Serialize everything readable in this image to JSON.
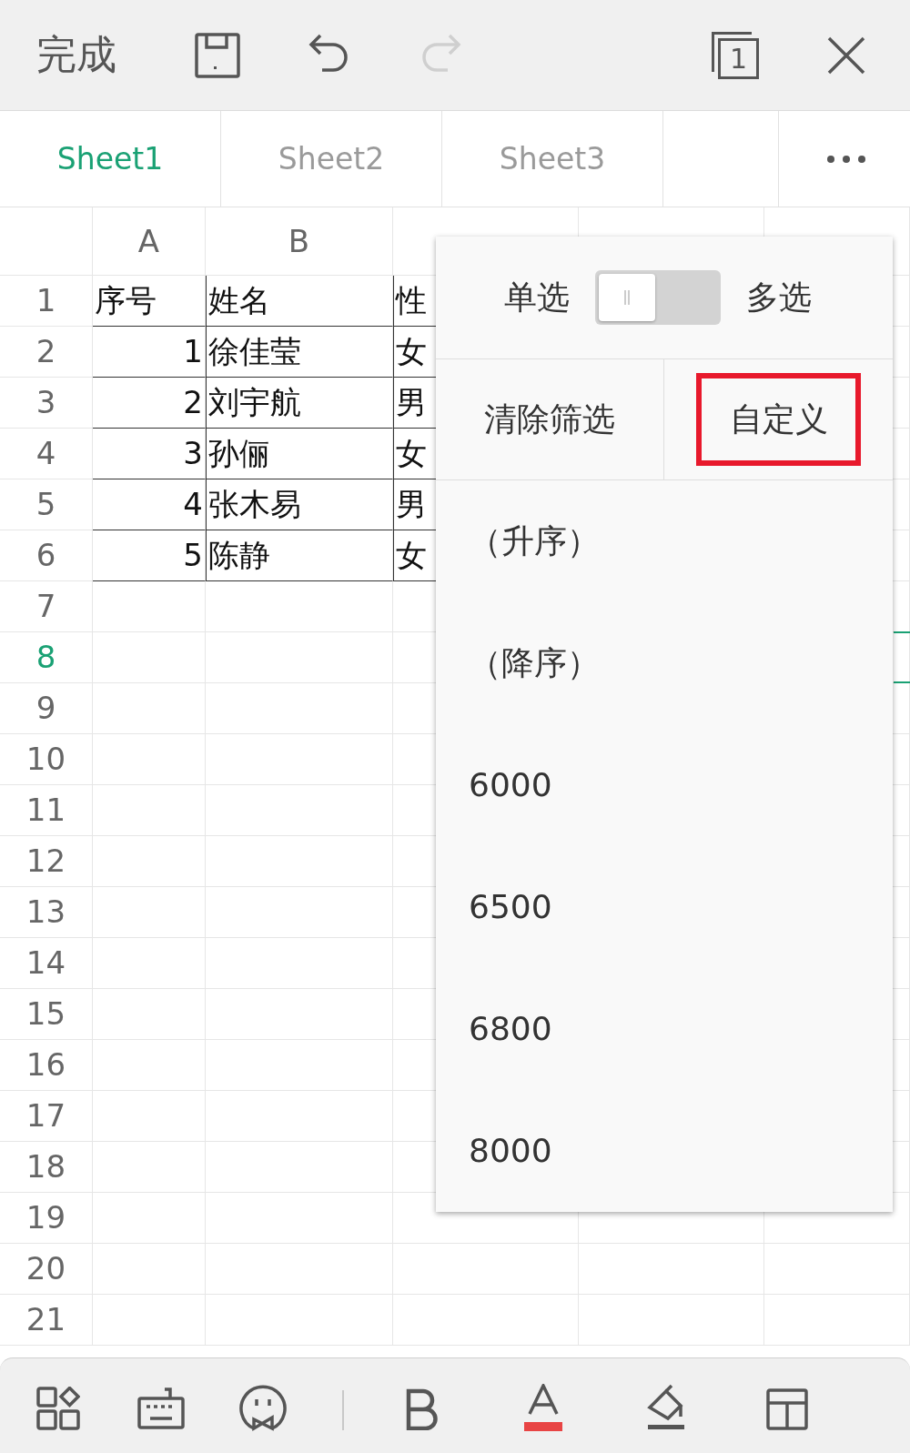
{
  "top_bar": {
    "done_label": "完成",
    "redo_disabled": true,
    "sheet_count": "1"
  },
  "sheet_tabs": [
    {
      "label": "Sheet1",
      "selected": true
    },
    {
      "label": "Sheet2",
      "selected": false
    },
    {
      "label": "Sheet3",
      "selected": false
    }
  ],
  "columns": [
    "A",
    "B"
  ],
  "rows": [
    {
      "number": "1",
      "kind": "header",
      "selected": false,
      "cells": [
        "序号",
        "姓名",
        "性"
      ]
    },
    {
      "number": "2",
      "kind": "data",
      "selected": false,
      "cells": [
        "1",
        "徐佳莹",
        "女"
      ]
    },
    {
      "number": "3",
      "kind": "data",
      "selected": false,
      "cells": [
        "2",
        "刘宇航",
        "男"
      ]
    },
    {
      "number": "4",
      "kind": "data",
      "selected": false,
      "cells": [
        "3",
        "孙俪",
        "女"
      ]
    },
    {
      "number": "5",
      "kind": "data",
      "selected": false,
      "cells": [
        "4",
        "张木易",
        "男"
      ]
    },
    {
      "number": "6",
      "kind": "data",
      "selected": false,
      "cells": [
        "5",
        "陈静",
        "女"
      ]
    },
    {
      "number": "7",
      "kind": "empty",
      "selected": false
    },
    {
      "number": "8",
      "kind": "empty",
      "selected": true
    },
    {
      "number": "9",
      "kind": "empty",
      "selected": false
    },
    {
      "number": "10",
      "kind": "empty",
      "selected": false
    },
    {
      "number": "11",
      "kind": "empty",
      "selected": false
    },
    {
      "number": "12",
      "kind": "empty",
      "selected": false
    },
    {
      "number": "13",
      "kind": "empty",
      "selected": false
    },
    {
      "number": "14",
      "kind": "empty",
      "selected": false
    },
    {
      "number": "15",
      "kind": "empty",
      "selected": false
    },
    {
      "number": "16",
      "kind": "empty",
      "selected": false
    },
    {
      "number": "17",
      "kind": "empty",
      "selected": false
    },
    {
      "number": "18",
      "kind": "empty",
      "selected": false
    },
    {
      "number": "19",
      "kind": "empty",
      "selected": false
    },
    {
      "number": "20",
      "kind": "empty",
      "selected": false
    },
    {
      "number": "21",
      "kind": "empty",
      "selected": false
    }
  ],
  "filter_popup": {
    "single_label": "单选",
    "multi_label": "多选",
    "multi_select": false,
    "clear_label": "清除筛选",
    "custom_label": "自定义",
    "custom_highlighted": true,
    "items": [
      "（升序）",
      "（降序）",
      "6000",
      "6500",
      "6800",
      "8000"
    ]
  }
}
